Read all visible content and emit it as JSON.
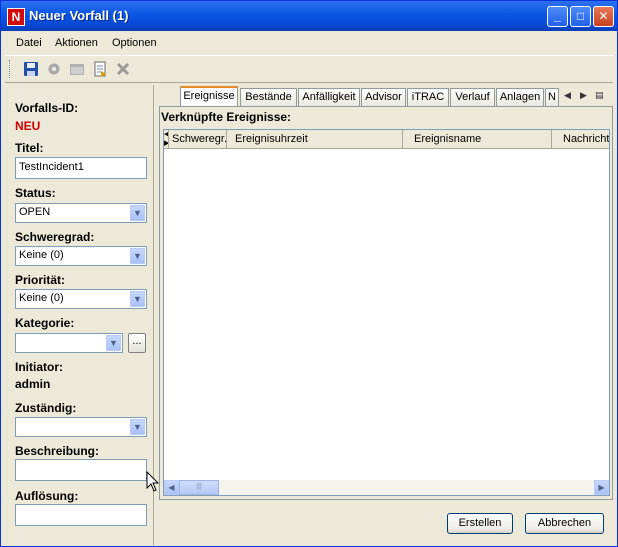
{
  "window": {
    "title": "Neuer Vorfall (1)",
    "app_icon_letter": "N",
    "controls": {
      "minimize": "_",
      "maximize": "□",
      "close": "✕"
    }
  },
  "menubar": {
    "items": [
      "Datei",
      "Aktionen",
      "Optionen"
    ]
  },
  "toolbar": {
    "icons": [
      "save-icon",
      "gear-icon",
      "window-icon",
      "export-icon",
      "delete-icon"
    ]
  },
  "form": {
    "id_label": "Vorfalls-ID:",
    "id_value": "NEU",
    "title_label": "Titel:",
    "title_value": "TestIncident1",
    "status_label": "Status:",
    "status_value": "OPEN",
    "severity_label": "Schweregrad:",
    "severity_value": "Keine (0)",
    "priority_label": "Priorität:",
    "priority_value": "Keine (0)",
    "category_label": "Kategorie:",
    "category_value": "",
    "category_browse": "...",
    "initiator_label": "Initiator:",
    "initiator_value": "admin",
    "assignee_label": "Zuständig:",
    "assignee_value": "",
    "description_label": "Beschreibung:",
    "description_value": "",
    "resolution_label": "Auflösung:",
    "resolution_value": ""
  },
  "tabs": [
    "Ereignisse",
    "Bestände",
    "Anfälligkeit",
    "Advisor",
    "iTRAC",
    "Verlauf",
    "Anlagen",
    "N"
  ],
  "tab_active_index": 0,
  "events": {
    "section_label": "Verknüpfte Ereignisse:",
    "columns": [
      "Schweregr.",
      "Ereignisuhrzeit",
      "Ereignisname",
      "Nachricht"
    ],
    "rows": []
  },
  "buttons": {
    "create": "Erstellen",
    "cancel": "Abbrechen"
  },
  "colors": {
    "titlebar": "#0a56e4",
    "id_value": "#cc0000",
    "tab_accent": "#e68b2c"
  }
}
